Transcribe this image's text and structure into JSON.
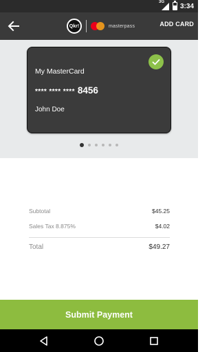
{
  "status_bar": {
    "network": "3G",
    "time": "3:34",
    "battery_level": 0.6
  },
  "app_bar": {
    "back_icon": "arrow-left-icon",
    "logo_text": "Qkr!",
    "partner_text": "masterpass",
    "add_card_label": "ADD CARD"
  },
  "card": {
    "name": "My MasterCard",
    "number_mask": "**** **** ****",
    "last4": "8456",
    "holder": "John Doe",
    "selected_icon": "checkmark-icon",
    "accent_color": "#8dc14a"
  },
  "carousel": {
    "count": 6,
    "active_index": 0
  },
  "totals": {
    "subtotal_label": "Subtotal",
    "subtotal_value": "$45.25",
    "tax_label": "Sales Tax 8.875%",
    "tax_value": "$4.02",
    "total_label": "Total",
    "total_value": "$49.27"
  },
  "submit": {
    "label": "Submit Payment",
    "color": "#8dbc3f"
  },
  "nav_bar": {
    "back_icon": "nav-back-icon",
    "home_icon": "nav-home-icon",
    "recents_icon": "nav-recents-icon"
  }
}
